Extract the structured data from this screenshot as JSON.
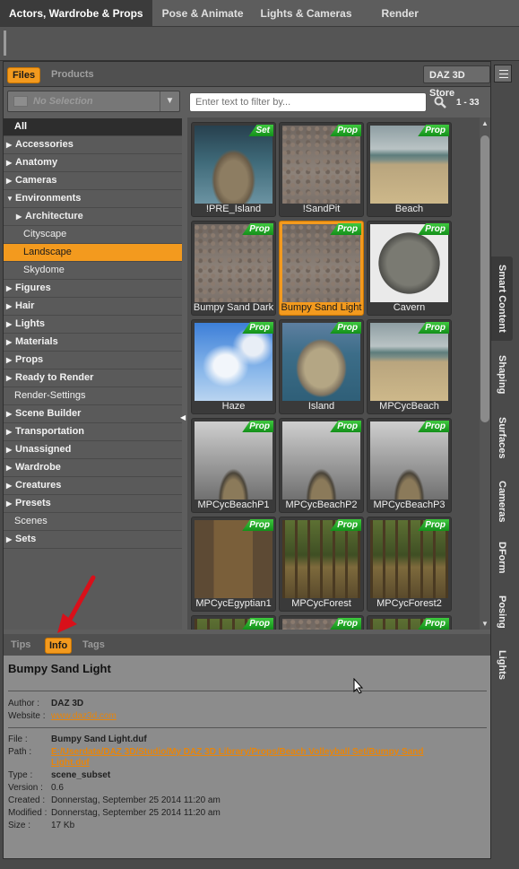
{
  "top_tabs": [
    "Actors, Wardrobe & Props",
    "Pose & Animate",
    "Lights & Cameras",
    "Render"
  ],
  "panel_tabs": {
    "files": "Files",
    "products": "Products",
    "store": "DAZ 3D Store"
  },
  "selector": {
    "label": "No Selection"
  },
  "filter": {
    "placeholder": "Enter text to filter by...",
    "count": "1 - 33"
  },
  "tree": [
    {
      "label": "All",
      "kind": "all"
    },
    {
      "label": "Accessories",
      "kind": "closed"
    },
    {
      "label": "Anatomy",
      "kind": "closed"
    },
    {
      "label": "Cameras",
      "kind": "closed"
    },
    {
      "label": "Environments",
      "kind": "open"
    },
    {
      "label": "Architecture",
      "kind": "subclosed"
    },
    {
      "label": "Cityscape",
      "kind": "sub"
    },
    {
      "label": "Landscape",
      "kind": "subselected"
    },
    {
      "label": "Skydome",
      "kind": "sub"
    },
    {
      "label": "Figures",
      "kind": "closed"
    },
    {
      "label": "Hair",
      "kind": "closed"
    },
    {
      "label": "Lights",
      "kind": "closed"
    },
    {
      "label": "Materials",
      "kind": "closed"
    },
    {
      "label": "Props",
      "kind": "closed"
    },
    {
      "label": "Ready to Render",
      "kind": "closed"
    },
    {
      "label": "Render-Settings",
      "kind": "plain"
    },
    {
      "label": "Scene Builder",
      "kind": "closed"
    },
    {
      "label": "Transportation",
      "kind": "closed"
    },
    {
      "label": "Unassigned",
      "kind": "closed"
    },
    {
      "label": "Wardrobe",
      "kind": "closed"
    },
    {
      "label": "Creatures",
      "kind": "closed"
    },
    {
      "label": "Presets",
      "kind": "closed"
    },
    {
      "label": "Scenes",
      "kind": "plain"
    },
    {
      "label": "Sets",
      "kind": "closed"
    }
  ],
  "items": [
    {
      "name": "!PRE_Island",
      "badge": "Set",
      "thumb": "island-tower"
    },
    {
      "name": "!SandPit",
      "badge": "Prop",
      "thumb": "sand"
    },
    {
      "name": "Beach",
      "badge": "Prop",
      "thumb": "beach"
    },
    {
      "name": "Bumpy Sand Dark",
      "badge": "Prop",
      "thumb": "sand"
    },
    {
      "name": "Bumpy Sand Light",
      "badge": "Prop",
      "thumb": "sand",
      "selected": true
    },
    {
      "name": "Cavern",
      "badge": "Prop",
      "thumb": "cavern"
    },
    {
      "name": "Haze",
      "badge": "Prop",
      "thumb": "sky"
    },
    {
      "name": "Island",
      "badge": "Prop",
      "thumb": "island"
    },
    {
      "name": "MPCycBeach",
      "badge": "Prop",
      "thumb": "beach"
    },
    {
      "name": "MPCycBeachP1",
      "badge": "Prop",
      "thumb": "cyc"
    },
    {
      "name": "MPCycBeachP2",
      "badge": "Prop",
      "thumb": "cyc"
    },
    {
      "name": "MPCycBeachP3",
      "badge": "Prop",
      "thumb": "cyc"
    },
    {
      "name": "MPCycEgyptian1",
      "badge": "Prop",
      "thumb": "egypt"
    },
    {
      "name": "MPCycForest",
      "badge": "Prop",
      "thumb": "forest"
    },
    {
      "name": "MPCycForest2",
      "badge": "Prop",
      "thumb": "forest"
    },
    {
      "name": "",
      "badge": "Prop",
      "thumb": "forest"
    },
    {
      "name": "",
      "badge": "Prop",
      "thumb": "sand"
    },
    {
      "name": "",
      "badge": "Prop",
      "thumb": "forest"
    }
  ],
  "info_tabs": {
    "tips": "Tips",
    "info": "Info",
    "tags": "Tags"
  },
  "info": {
    "title": "Bumpy Sand Light",
    "author_k": "Author :",
    "author": "DAZ 3D",
    "website_k": "Website :",
    "website": "www.daz3d.com",
    "file_k": "File :",
    "file": "Bumpy Sand Light.duf",
    "path_k": "Path :",
    "path1": "E:/Userdata/DAZ 3D/Studio/My DAZ 3D Library/Props/Beach Volleyball Set/Bumpy Sand",
    "path2": "Light.duf",
    "type_k": "Type :",
    "type": "scene_subset",
    "version_k": "Version :",
    "version": "0.6",
    "created_k": "Created :",
    "created": "Donnerstag, September 25 2014 11:20 am",
    "modified_k": "Modified :",
    "modified": "Donnerstag, September 25 2014 11:20 am",
    "size_k": "Size :",
    "size": "17 Kb"
  },
  "side_tabs": [
    "Smart Content",
    "Shaping",
    "Surfaces",
    "Cameras",
    "DForm",
    "Posing",
    "Lights"
  ]
}
